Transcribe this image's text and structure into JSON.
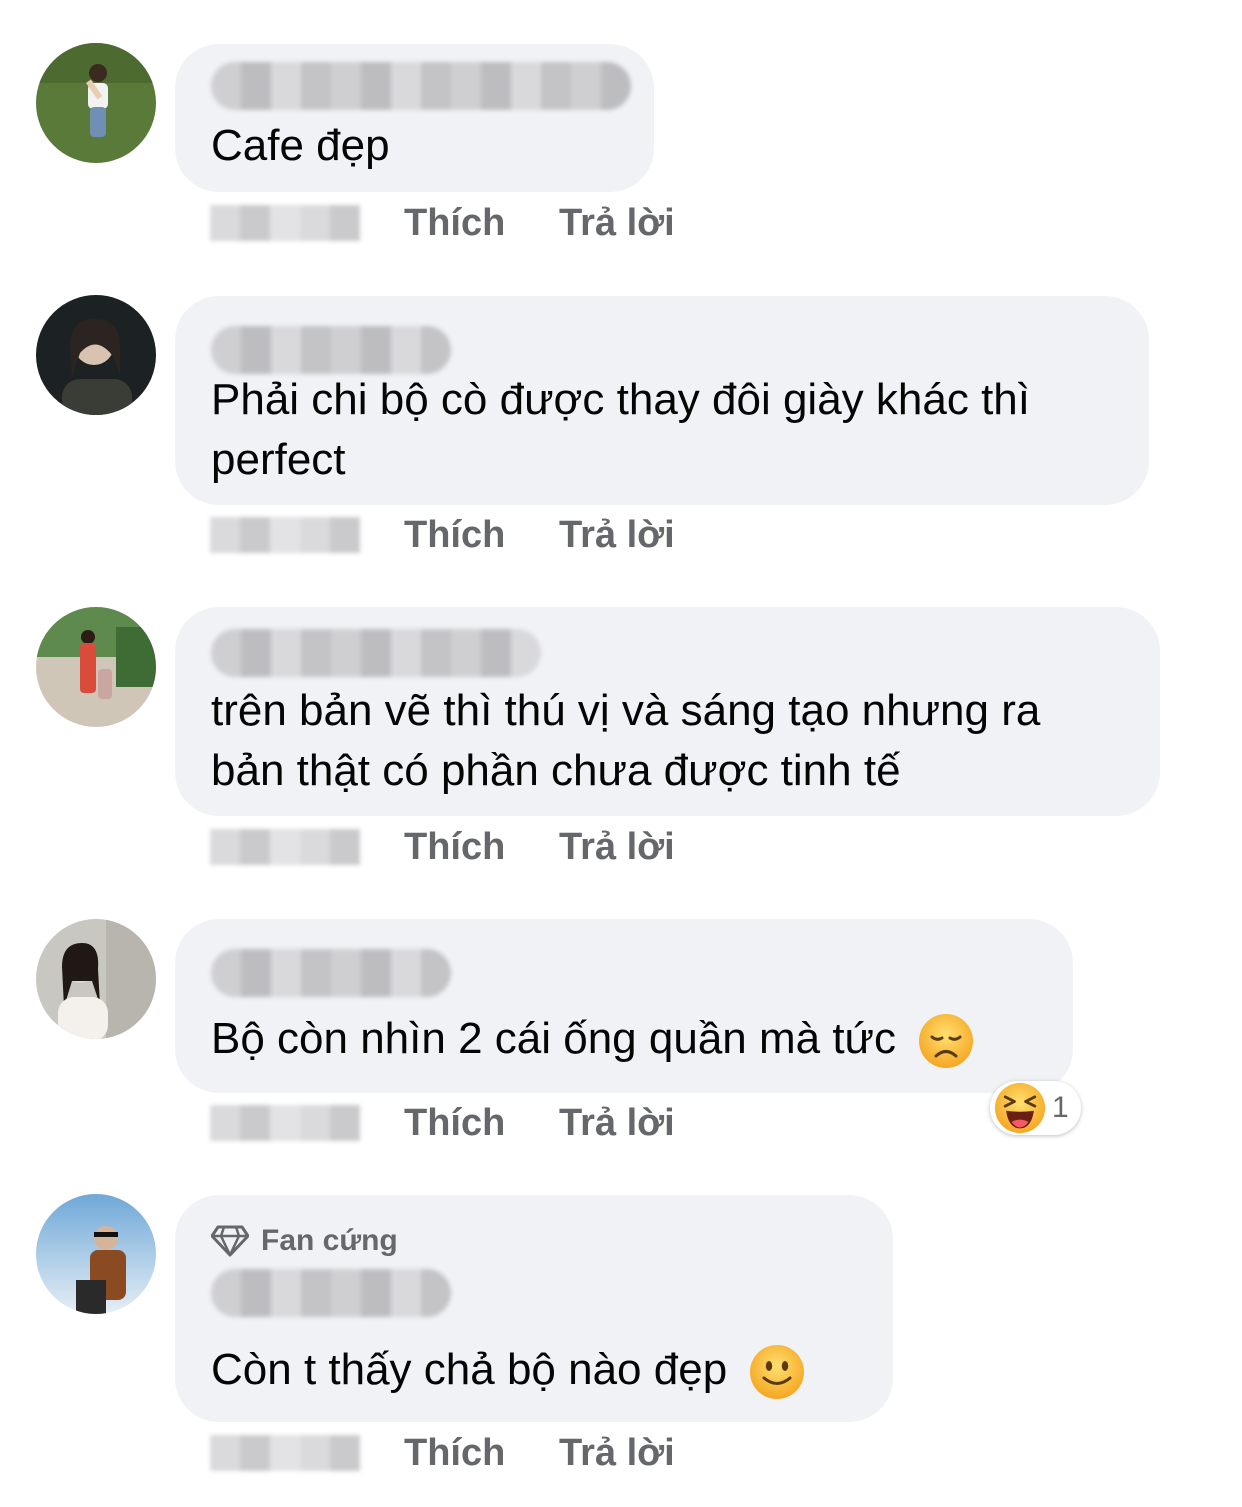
{
  "actions": {
    "like_label": "Thích",
    "reply_label": "Trả lời"
  },
  "comments": [
    {
      "text_lines": [
        "Cafe đẹp"
      ],
      "author_blurred": true,
      "timestamp_blurred": true
    },
    {
      "text_lines": [
        "Phải chi bộ cò được thay đôi giày khác thì",
        "perfect"
      ],
      "author_blurred": true,
      "timestamp_blurred": true
    },
    {
      "text_lines": [
        "trên bản vẽ thì thú vị và sáng tạo nhưng ra",
        "bản thật có phần chưa được tinh tế"
      ],
      "author_blurred": true,
      "timestamp_blurred": true
    },
    {
      "text_lines": [
        "Bộ còn nhìn 2 cái ống quần mà tức"
      ],
      "trailing_emoji": "disappointed-face",
      "reaction": {
        "emoji": "laughing-face",
        "count": "1"
      },
      "author_blurred": true,
      "timestamp_blurred": true
    },
    {
      "badge": {
        "icon": "diamond-icon",
        "label": "Fan cứng"
      },
      "text_lines": [
        "Còn t thấy chả bộ nào đẹp"
      ],
      "trailing_emoji": "slightly-smiling-face",
      "author_blurred": true,
      "timestamp_blurred": true
    }
  ],
  "colors": {
    "bubble_bg": "#f0f2f5",
    "secondary_text": "#65676b",
    "primary_text": "#050505"
  }
}
